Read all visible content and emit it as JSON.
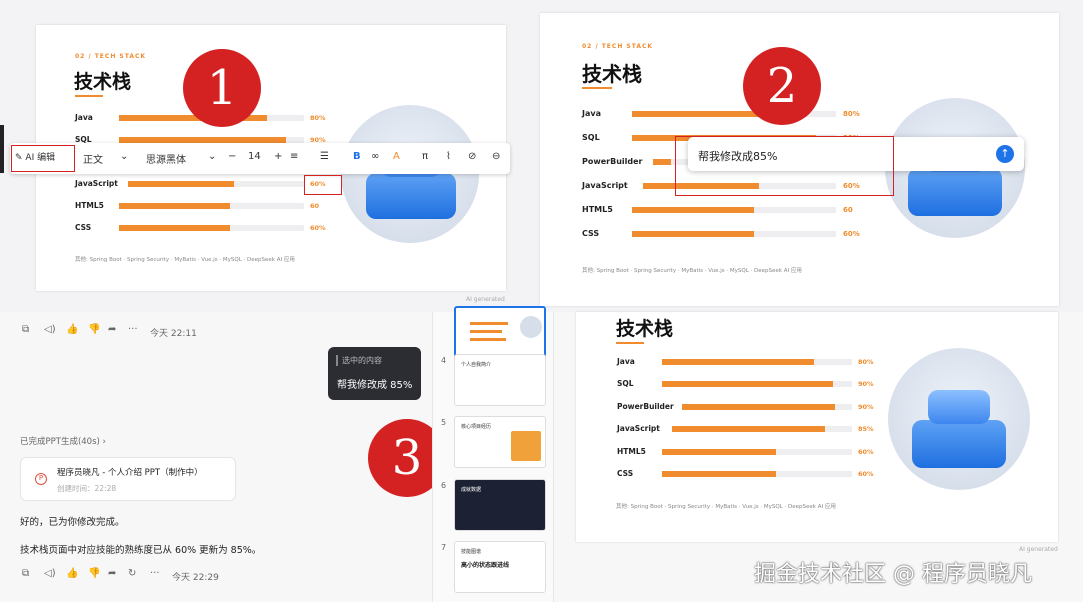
{
  "slide": {
    "eyebrow": "02 / TECH STACK",
    "title": "技术栈",
    "footer": "其他: Spring Boot · Spring Security · MyBatis · Vue.js · MySQL · DeepSeek AI 应用",
    "ai_generated": "AI generated"
  },
  "panel1": {
    "skills": [
      {
        "label": "Java",
        "pct": "80%",
        "value": 0.8
      },
      {
        "label": "SQL",
        "pct": "90%",
        "value": 0.9
      },
      {
        "label": "JavaScript",
        "pct": "60%",
        "value": 0.6
      },
      {
        "label": "HTML5",
        "pct": "60",
        "value": 0.6
      },
      {
        "label": "CSS",
        "pct": "60%",
        "value": 0.6
      }
    ],
    "toolbar": {
      "ai_edit": "AI 编辑",
      "style": "正文",
      "font": "思源黑体",
      "minus": "−",
      "size": "14",
      "plus": "+",
      "bold": "B",
      "color_a": "A",
      "pi": "π"
    },
    "marker": "1"
  },
  "panel2": {
    "skills": [
      {
        "label": "Java",
        "pct": "80%",
        "value": 0.8
      },
      {
        "label": "SQL",
        "pct": "90%",
        "value": 0.9
      },
      {
        "label": "PowerBuilder",
        "pct": "",
        "value": 0.1
      },
      {
        "label": "JavaScript",
        "pct": "60%",
        "value": 0.6
      },
      {
        "label": "HTML5",
        "pct": "60",
        "value": 0.6
      },
      {
        "label": "CSS",
        "pct": "60%",
        "value": 0.6
      }
    ],
    "prompt_text": "帮我修改成85%",
    "marker": "2"
  },
  "panel3": {
    "marker": "3",
    "chat": {
      "time1": "今天 22:11",
      "quote_label": "选中的内容",
      "user_msg": "帮我修改成 85%",
      "done_label": "已完成PPT生成(40s)",
      "card_title": "程序员晓凡 - 个人介绍 PPT（制作中）",
      "card_time": "创建时间：22:28",
      "reply1": "好的，已为你修改完成。",
      "reply2": "技术栈页面中对应技能的熟练度已从 60% 更新为 85%。",
      "time2": "今天 22:29"
    },
    "thumbs": [
      {
        "num": "4",
        "title": "个人自我简介"
      },
      {
        "num": "5",
        "title": "核心项目经历"
      },
      {
        "num": "6",
        "title": "成就数据"
      },
      {
        "num": "7",
        "title": "技能图谱",
        "sub": "高小的状态跟进线"
      }
    ],
    "skills": [
      {
        "label": "Java",
        "pct": "80%",
        "value": 0.8
      },
      {
        "label": "SQL",
        "pct": "90%",
        "value": 0.9
      },
      {
        "label": "PowerBuilder",
        "pct": "90%",
        "value": 0.9
      },
      {
        "label": "JavaScript",
        "pct": "85%",
        "value": 0.85
      },
      {
        "label": "HTML5",
        "pct": "60%",
        "value": 0.6
      },
      {
        "label": "CSS",
        "pct": "60%",
        "value": 0.6
      }
    ]
  },
  "watermark": "掘金技术社区 @ 程序员晓凡",
  "colors": {
    "accent": "#f08b2e",
    "red": "#d42121",
    "blue": "#1e73e8"
  }
}
